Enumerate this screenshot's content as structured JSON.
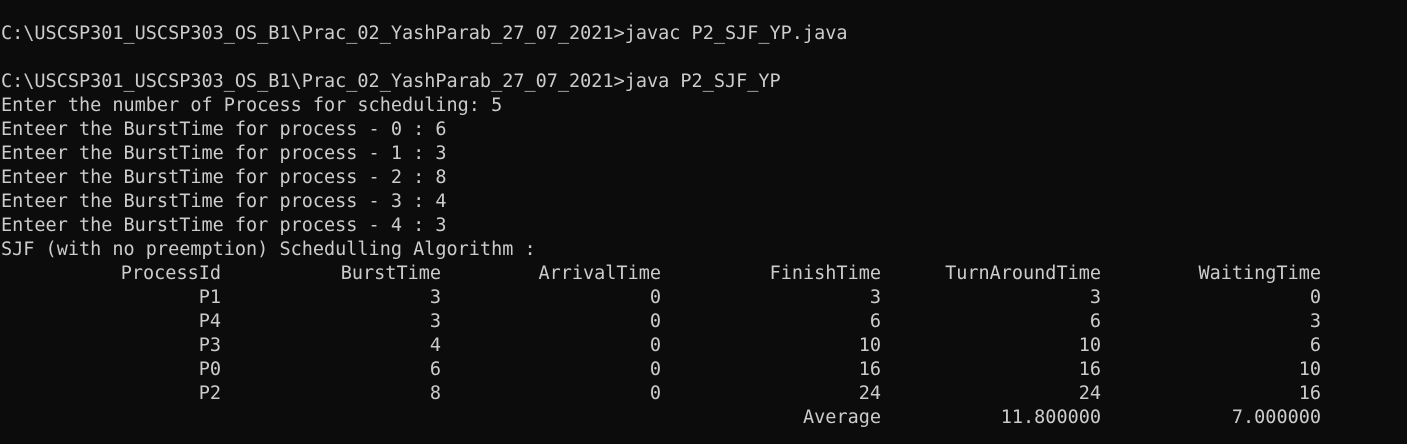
{
  "console": {
    "lines": [
      "C:\\USCSP301_USCSP303_OS_B1\\Prac_02_YashParab_27_07_2021>javac P2_SJF_YP.java",
      "",
      "C:\\USCSP301_USCSP303_OS_B1\\Prac_02_YashParab_27_07_2021>java P2_SJF_YP",
      "Enter the number of Process for scheduling: 5",
      "Enteer the BurstTime for process - 0 : 6",
      "Enteer the BurstTime for process - 1 : 3",
      "Enteer the BurstTime for process - 2 : 8",
      "Enteer the BurstTime for process - 3 : 4",
      "Enteer the BurstTime for process - 4 : 3",
      "SJF (with no preemption) Schedulling Algorithm :"
    ]
  },
  "table": {
    "headers": [
      "ProcessId",
      "BurstTime",
      "ArrivalTime",
      "FinishTime",
      "TurnAroundTime",
      "WaitingTime"
    ],
    "rows": [
      [
        "P1",
        "3",
        "0",
        "3",
        "3",
        "0"
      ],
      [
        "P4",
        "3",
        "0",
        "6",
        "6",
        "3"
      ],
      [
        "P3",
        "4",
        "0",
        "10",
        "10",
        "6"
      ],
      [
        "P0",
        "6",
        "0",
        "16",
        "16",
        "10"
      ],
      [
        "P2",
        "8",
        "0",
        "24",
        "24",
        "16"
      ]
    ],
    "average": [
      "",
      "",
      "",
      "Average",
      "11.800000",
      "7.000000"
    ]
  },
  "colors": {
    "background": "#0c0c0c",
    "text": "#cccccc"
  }
}
